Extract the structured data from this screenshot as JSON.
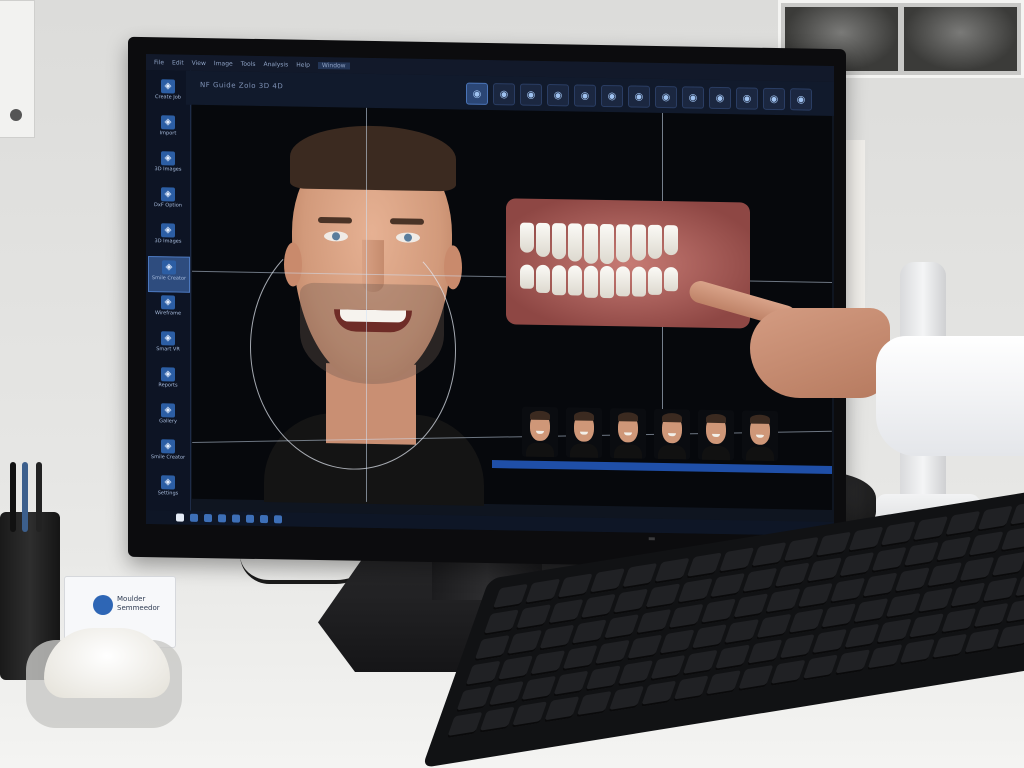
{
  "scene": {
    "business_card": {
      "line1": "Moulder",
      "line2": "Semmeedor"
    }
  },
  "app": {
    "menu": [
      "File",
      "Edit",
      "View",
      "Image",
      "Tools",
      "Analysis",
      "Help",
      "Window"
    ],
    "active_menu": "Window",
    "toolbar_title": "NF  Guide  Zolo  3D  4D",
    "tools": [
      "smile-design-tool",
      "face-tool",
      "ruler-tool",
      "photo-tool",
      "mirror-tool",
      "shade-tool",
      "grid-tool",
      "overlay-tool",
      "layer-tool",
      "export-tool",
      "compare-tool",
      "undo-tool",
      "redo-tool"
    ]
  },
  "sidebar": {
    "items": [
      {
        "label": "Create Job",
        "icon": "add-icon"
      },
      {
        "label": "Import",
        "icon": "import-icon"
      },
      {
        "label": "3D Images",
        "icon": "images-icon"
      },
      {
        "label": "DxF Option",
        "icon": "options-icon"
      },
      {
        "label": "3D Images",
        "icon": "images-icon"
      },
      {
        "label": "Smile Creator",
        "icon": "smile-icon"
      },
      {
        "label": "Wireframe",
        "icon": "wireframe-icon"
      },
      {
        "label": "Smart VR",
        "icon": "vr-icon"
      },
      {
        "label": "Reports",
        "icon": "reports-icon"
      },
      {
        "label": "Gallery",
        "icon": "gallery-icon"
      },
      {
        "label": "Smile Creator",
        "icon": "smile-icon"
      },
      {
        "label": "Settings",
        "icon": "settings-icon"
      }
    ],
    "active_index": 5
  },
  "thumbnails": {
    "count": 6
  },
  "colors": {
    "accent": "#2e66b5",
    "sidebar_active": "#2e4c7e",
    "background": "#0f1520"
  }
}
